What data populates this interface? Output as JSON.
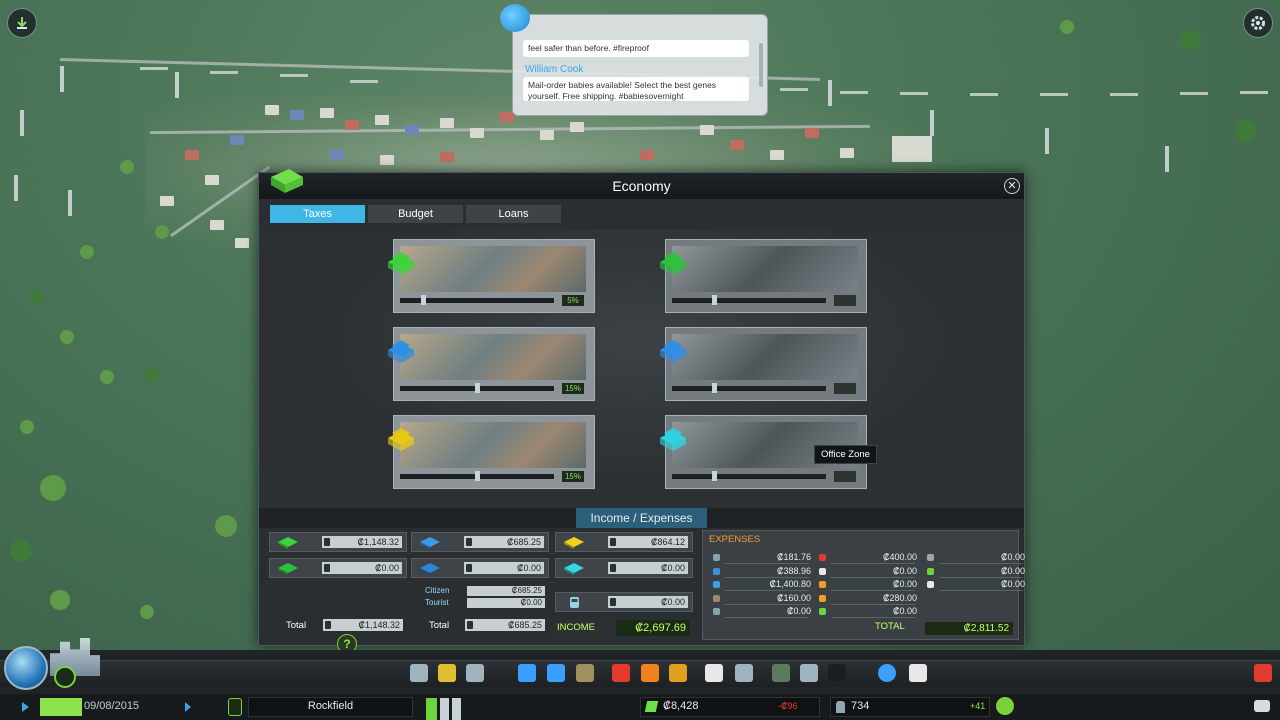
{
  "chirper": {
    "chirp1_text": "feel safer than before. #fireproof",
    "chirp2_author": "William Cook",
    "chirp2_text": "Mail-order babies available! Select the best genes yourself. Free shipping. #babiesovernight"
  },
  "economy": {
    "title": "Economy",
    "tabs": [
      {
        "label": "Taxes",
        "active": true
      },
      {
        "label": "Budget",
        "active": false
      },
      {
        "label": "Loans",
        "active": false
      }
    ],
    "tax_cards": [
      {
        "zone": "residential-low",
        "color": "#3bd43b",
        "value_label": "5%",
        "slider_fraction": 0.14,
        "enabled": true
      },
      {
        "zone": "residential-high",
        "color": "#2ec23a",
        "value_label": "",
        "slider_fraction": 0.27,
        "enabled": false
      },
      {
        "zone": "commercial-low",
        "color": "#2f8fe3",
        "value_label": "15%",
        "slider_fraction": 0.5,
        "enabled": true
      },
      {
        "zone": "commercial-high",
        "color": "#2f8fe3",
        "value_label": "",
        "slider_fraction": 0.27,
        "enabled": false
      },
      {
        "zone": "industrial",
        "color": "#e6c814",
        "value_label": "15%",
        "slider_fraction": 0.5,
        "enabled": true
      },
      {
        "zone": "office",
        "color": "#2fd3e0",
        "value_label": "",
        "slider_fraction": 0.27,
        "enabled": false
      }
    ],
    "tooltip": "Office Zone",
    "income_expenses_title": "Income / Expenses",
    "income": {
      "residential_low": "₡1,148.32",
      "residential_high": "₡0.00",
      "residential_total": "₡1,148.32",
      "commercial_low": "₡685.25",
      "commercial_high": "₡0.00",
      "citizen_label": "Citizen",
      "citizen_value": "₡685.25",
      "tourist_label": "Tourist",
      "tourist_value": "₡0.00",
      "commercial_total": "₡685.25",
      "industrial": "₡864.12",
      "office": "₡0.00",
      "public_transport": "₡0.00",
      "total_label": "Total",
      "income_label": "INCOME",
      "income_total": "₡2,697.69"
    },
    "expenses": {
      "title": "EXPENSES",
      "col1": [
        "₡181.76",
        "₡388.96",
        "₡1,400.80",
        "₡160.00",
        "₡0.00"
      ],
      "col2": [
        "₡400.00",
        "₡0.00",
        "₡0.00",
        "₡280.00",
        "₡0.00"
      ],
      "col3": [
        "₡0.00",
        "₡0.00",
        "₡0.00"
      ],
      "total_label": "TOTAL",
      "total": "₡2,811.52"
    }
  },
  "bottom_bar": {
    "date": "09/08/2015",
    "city_name": "Rockfield",
    "money": "₡8,428",
    "money_change": "-₡96",
    "population": "734",
    "population_change": "+41"
  }
}
